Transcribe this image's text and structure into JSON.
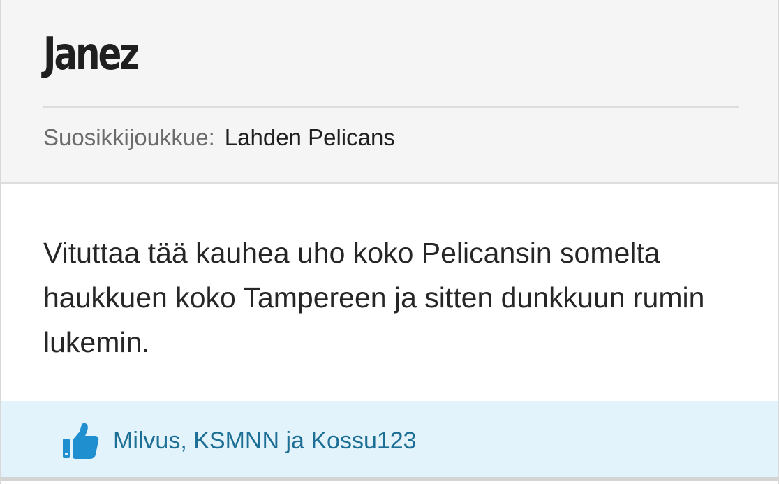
{
  "post": {
    "username": "Janez",
    "team_label": "Suosikkijoukkue:",
    "team_value": "Lahden Pelicans",
    "message": "Vituttaa tää kauhea uho koko Pelicansin somelta haukkuen koko Tampereen ja sitten dunkkuun rumin lukemin.",
    "likes": {
      "icon": "thumbs-up-icon",
      "text": "Milvus, KSMNN ja Kossu123"
    }
  },
  "colors": {
    "header_bg": "#f5f5f5",
    "likes_bg": "#e3f3fb",
    "accent": "#1f8fd0",
    "link": "#1d6f95"
  }
}
